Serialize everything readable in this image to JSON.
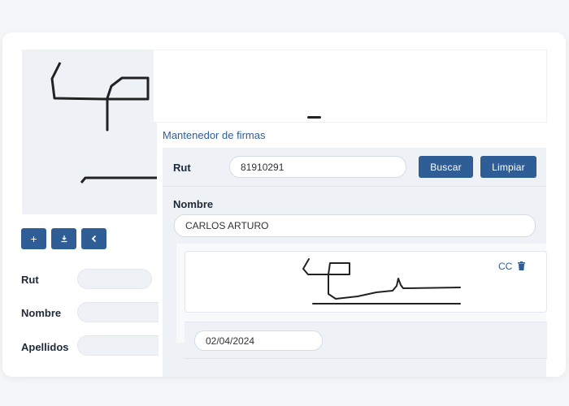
{
  "left_form": {
    "rut_label": "Rut",
    "nombre_label": "Nombre",
    "apellidos_label": "Apellidos"
  },
  "toolbar": {
    "add_icon": "+",
    "download_icon": "download-icon",
    "back_icon": "chevron-left-icon"
  },
  "section_title": "Mantenedor de firmas",
  "form": {
    "rut_label": "Rut",
    "rut_value": "81910291",
    "buscar_label": "Buscar",
    "limpiar_label": "Limpiar",
    "nombre_label": "Nombre",
    "nombre_value": "CARLOS ARTURO"
  },
  "signature_card": {
    "cc_label": "CC",
    "date_value": "02/04/2024"
  },
  "colors": {
    "accent": "#2f5e96",
    "panel_bg": "#eef1f6"
  }
}
